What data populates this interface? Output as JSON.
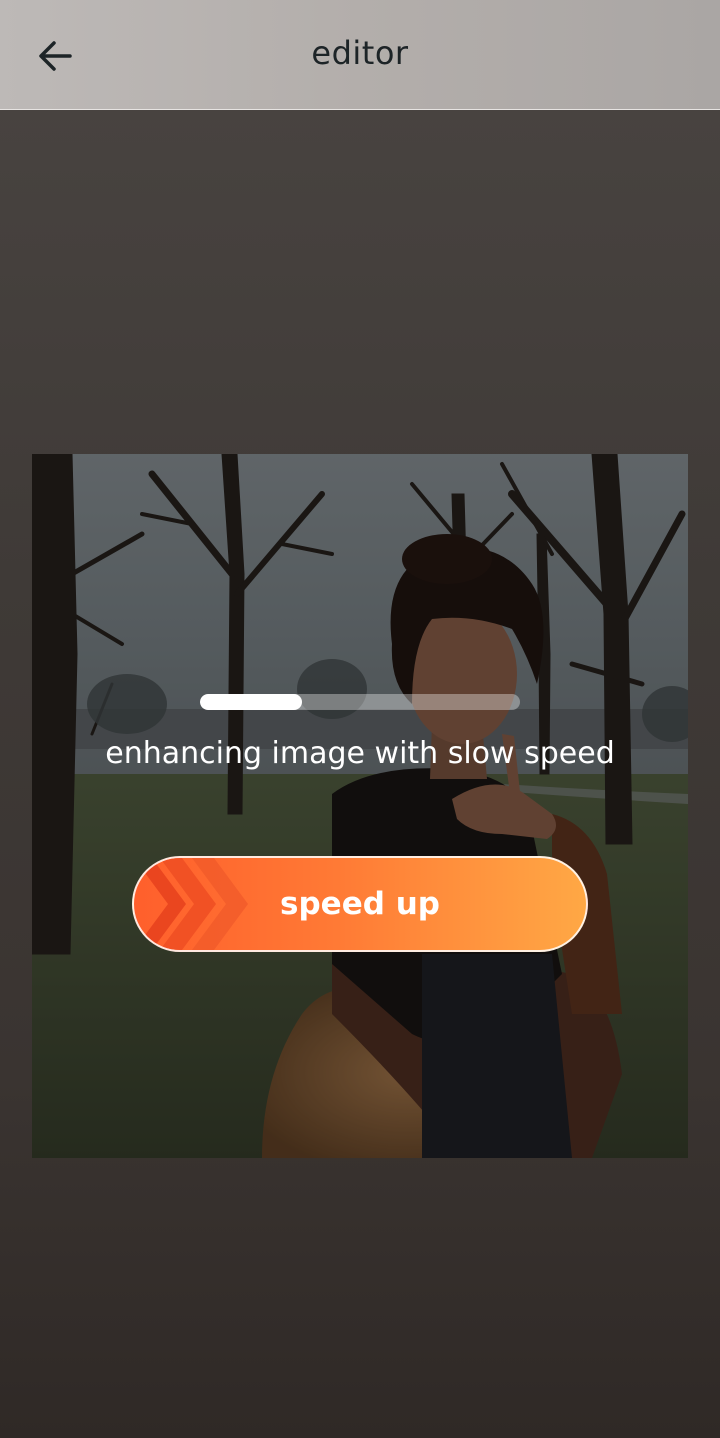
{
  "header": {
    "title": "editor",
    "back_icon": "arrow-left-icon"
  },
  "enhance": {
    "progress": 0.32,
    "status_text": "enhancing image with slow speed",
    "button_label": "speed up",
    "button_icon": "chevrons-right-icon"
  },
  "colors": {
    "header_bg": "#b3aeab",
    "accent_start": "#ff5f2c",
    "accent_end": "#ffa845"
  }
}
